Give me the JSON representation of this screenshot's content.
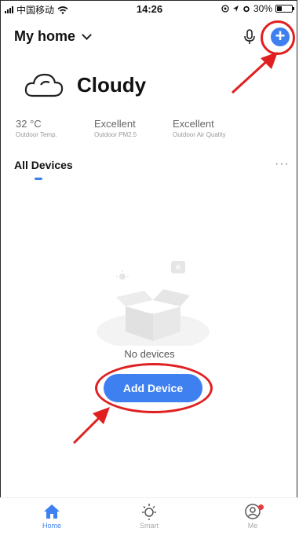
{
  "status_bar": {
    "carrier": "中国移动",
    "time": "14:26",
    "battery": "30%",
    "battery_level": 0.3
  },
  "header": {
    "home_name": "My home"
  },
  "weather": {
    "condition": "Cloudy",
    "stats": [
      {
        "value": "32 °C",
        "label": "Outdoor Temp."
      },
      {
        "value": "Excellent",
        "label": "Outdoor PM2.5"
      },
      {
        "value": "Excellent",
        "label": "Outdoor Air Quality"
      }
    ]
  },
  "devices": {
    "section_title": "All Devices",
    "more_label": "···",
    "empty_text": "No devices",
    "add_button_label": "Add Device"
  },
  "tabbar": {
    "tabs": [
      {
        "label": "Home",
        "icon": "home-icon",
        "active": true
      },
      {
        "label": "Smart",
        "icon": "sun-icon",
        "active": false
      },
      {
        "label": "Me",
        "icon": "user-icon",
        "active": false
      }
    ]
  },
  "colors": {
    "accent": "#3f80f0",
    "annotation": "#e02020"
  }
}
